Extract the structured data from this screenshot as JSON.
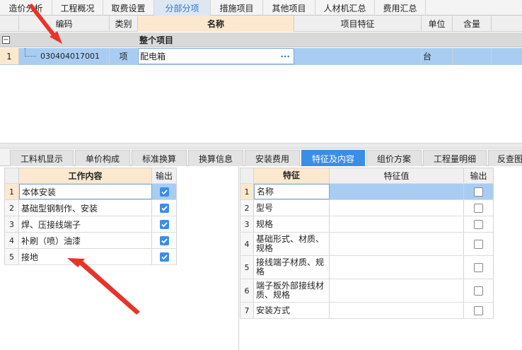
{
  "top_tabs": [
    {
      "label": "造价分析",
      "width": 74
    },
    {
      "label": "工程概况",
      "width": 72
    },
    {
      "label": "取费设置",
      "width": 72
    },
    {
      "label": "分部分项",
      "width": 80,
      "active": true
    },
    {
      "label": "措施项目",
      "width": 74
    },
    {
      "label": "其他项目",
      "width": 74
    },
    {
      "label": "人材机汇总",
      "width": 84
    },
    {
      "label": "费用汇总",
      "width": 72
    }
  ],
  "grid": {
    "headers": {
      "code": "编码",
      "type": "类别",
      "name": "名称",
      "feature": "项目特征",
      "unit": "单位",
      "qty": "含量"
    },
    "group_row": {
      "collapse_symbol": "−",
      "label": "整个项目"
    },
    "row": {
      "index": "1",
      "code": "030404017001",
      "type": "项",
      "name": "配电箱",
      "ellipsis": "···",
      "unit": "台"
    }
  },
  "bottom_tabs": [
    {
      "label": "工料机显示"
    },
    {
      "label": "单价构成"
    },
    {
      "label": "标准换算"
    },
    {
      "label": "换算信息"
    },
    {
      "label": "安装费用"
    },
    {
      "label": "特征及内容",
      "active": true
    },
    {
      "label": "组价方案"
    },
    {
      "label": "工程量明细"
    },
    {
      "label": "反查图"
    }
  ],
  "work_table": {
    "header_content": "工作内容",
    "header_output": "输出",
    "rows": [
      {
        "index": "1",
        "content": "本体安装",
        "checked": true
      },
      {
        "index": "2",
        "content": "基础型钢制作、安装",
        "checked": true
      },
      {
        "index": "3",
        "content": "焊、压接线端子",
        "checked": true
      },
      {
        "index": "4",
        "content": "补刷（喷）油漆",
        "checked": true
      },
      {
        "index": "5",
        "content": "接地",
        "checked": true
      }
    ]
  },
  "feature_table": {
    "header_feature": "特征",
    "header_value": "特征值",
    "header_output": "输出",
    "rows": [
      {
        "index": "1",
        "feature": "名称",
        "value": "",
        "checked": false
      },
      {
        "index": "2",
        "feature": "型号",
        "value": "",
        "checked": false
      },
      {
        "index": "3",
        "feature": "规格",
        "value": "",
        "checked": false
      },
      {
        "index": "4",
        "feature": "基础形式、材质、规格",
        "value": "",
        "checked": false
      },
      {
        "index": "5",
        "feature": "接线端子材质、规格",
        "value": "",
        "checked": false
      },
      {
        "index": "6",
        "feature": "端子板外部接线材质、规格",
        "value": "",
        "checked": false
      },
      {
        "index": "7",
        "feature": "安装方式",
        "value": "",
        "checked": false
      }
    ]
  },
  "colors": {
    "accent": "#3a8ee6",
    "selection": "#a9cdf2",
    "header_highlight": "#fbe8cf",
    "annotation_arrow": "#e8332a"
  }
}
